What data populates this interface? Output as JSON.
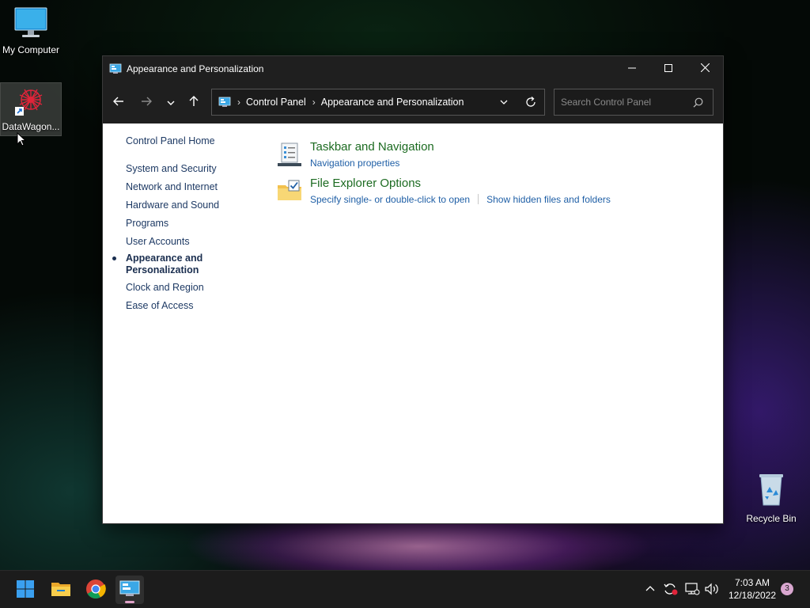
{
  "desktop": {
    "icons": [
      {
        "label": "My Computer",
        "icon": "monitor-icon"
      },
      {
        "label": "DataWagon...",
        "icon": "datawagon-shortcut-icon"
      },
      {
        "label": "Recycle Bin",
        "icon": "recycle-bin-icon"
      }
    ]
  },
  "window": {
    "title": "Appearance and Personalization",
    "controls": {
      "minimize": "minimize-icon",
      "maximize": "maximize-icon",
      "close": "close-icon"
    }
  },
  "navigation": {
    "breadcrumb": [
      "Control Panel",
      "Appearance and Personalization"
    ],
    "search_placeholder": "Search Control Panel"
  },
  "left_nav": {
    "home": "Control Panel Home",
    "items": [
      {
        "label": "System and Security",
        "active": false
      },
      {
        "label": "Network and Internet",
        "active": false
      },
      {
        "label": "Hardware and Sound",
        "active": false
      },
      {
        "label": "Programs",
        "active": false
      },
      {
        "label": "User Accounts",
        "active": false
      },
      {
        "label": "Appearance and Personalization",
        "active": true
      },
      {
        "label": "Clock and Region",
        "active": false
      },
      {
        "label": "Ease of Access",
        "active": false
      }
    ]
  },
  "sections": [
    {
      "title": "Taskbar and Navigation",
      "icon": "taskbar-icon",
      "links": [
        "Navigation properties"
      ]
    },
    {
      "title": "File Explorer Options",
      "icon": "folder-options-icon",
      "links": [
        "Specify single- or double-click to open",
        "Show hidden files and folders"
      ]
    }
  ],
  "taskbar": {
    "apps": [
      "start-icon",
      "file-explorer-icon",
      "chrome-icon",
      "control-panel-icon"
    ],
    "time": "7:03 AM",
    "date": "12/18/2022",
    "notification_count": "3"
  },
  "colors": {
    "section_title": "#1c6b21",
    "link": "#1f5fa6",
    "left_nav": "#1e3a64",
    "titlebar": "#1f1f1f",
    "taskbar": "#1c1c1c"
  }
}
